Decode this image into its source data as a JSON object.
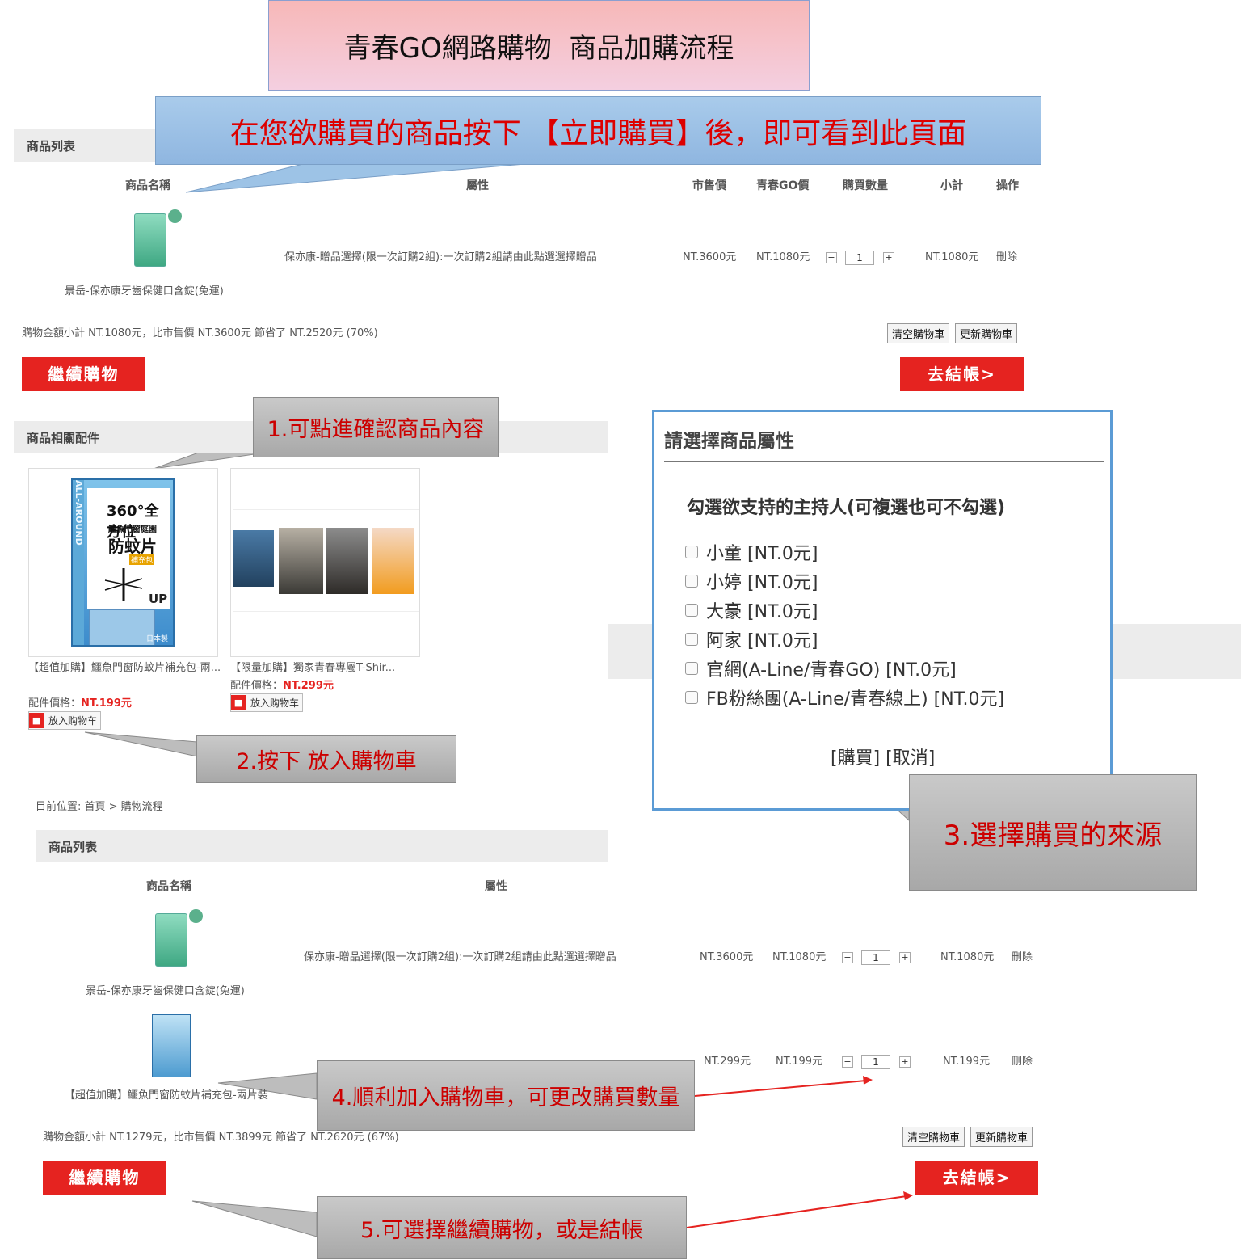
{
  "title_banner": "青春GO網路購物  商品加購流程",
  "intro_callout": "在您欲購買的商品按下 【立即購買】後，即可看到此頁面",
  "cart1": {
    "section_title": "商品列表",
    "headers": {
      "name": "商品名稱",
      "attr": "屬性",
      "market": "市售價",
      "go_price": "青春GO價",
      "qty": "購買數量",
      "subtotal": "小計",
      "action": "操作"
    },
    "item": {
      "name": "景岳-保亦康牙齒保健口含錠(兔運)",
      "attr": "保亦康-贈品選擇(限一次訂購2組):一次訂購2組請由此點選選擇贈品",
      "market": "NT.3600元",
      "go_price": "NT.1080元",
      "qty": "1",
      "subtotal": "NT.1080元",
      "action": "刪除"
    },
    "summary": "購物金額小計 NT.1080元，比市售價 NT.3600元 節省了 NT.2520元 (70%)",
    "clear_btn": "清空購物車",
    "update_btn": "更新購物車",
    "continue_btn": "繼續購物",
    "checkout_btn": "去結帳>"
  },
  "accessories": {
    "section_title": "商品相關配件",
    "items": [
      {
        "title": "【超值加購】鱷魚門窗防蚊片補充包-兩...",
        "price_label": "配件價格：",
        "price": "NT.199元",
        "add_btn": "放入购物车",
        "img_text": {
          "a": "360°全方位",
          "b": "鱷魚門窗庭園",
          "c": "防蚊片",
          "d": "補充包",
          "e": "UP",
          "f": "ALL-AROUND",
          "g": "日本製"
        }
      },
      {
        "title": "【限量加購】獨家青春專屬T-Shir...",
        "price_label": "配件價格：",
        "price": "NT.299元",
        "add_btn": "放入购物车"
      }
    ]
  },
  "step1": "1.可點進確認商品內容",
  "step2": "2.按下 放入購物車",
  "modal": {
    "title": "請選擇商品屬性",
    "question": "勾選欲支持的主持人(可複選也可不勾選)",
    "options": [
      "小童 [NT.0元]",
      "小婷 [NT.0元]",
      "大豪 [NT.0元]",
      "阿家 [NT.0元]",
      "官網(A-Line/青春GO) [NT.0元]",
      "FB粉絲團(A-Line/青春線上) [NT.0元]"
    ],
    "buy": "[購買]",
    "cancel": "[取消]"
  },
  "step3": "3.選擇購買的來源",
  "breadcrumb": "目前位置: 首頁 > 購物流程",
  "cart2": {
    "section_title": "商品列表",
    "headers": {
      "name": "商品名稱",
      "attr": "屬性"
    },
    "items": [
      {
        "name": "景岳-保亦康牙齒保健口含錠(兔運)",
        "attr": "保亦康-贈品選擇(限一次訂購2組):一次訂購2組請由此點選選擇贈品",
        "market": "NT.3600元",
        "go_price": "NT.1080元",
        "qty": "1",
        "subtotal": "NT.1080元",
        "action": "刪除"
      },
      {
        "name": "【超值加購】鱷魚門窗防蚊片補充包-兩片裝",
        "attr": "",
        "market": "NT.299元",
        "go_price": "NT.199元",
        "qty": "1",
        "subtotal": "NT.199元",
        "action": "刪除"
      }
    ],
    "summary": "購物金額小計 NT.1279元，比市售價 NT.3899元 節省了 NT.2620元 (67%)",
    "clear_btn": "清空購物車",
    "update_btn": "更新購物車",
    "continue_btn": "繼續購物",
    "checkout_btn": "去結帳>"
  },
  "step4": "4.順利加入購物車，可更改購買數量",
  "step5": "5.可選擇繼續購物，或是結帳",
  "colors": {
    "red": "#e52320",
    "blue_callout": "#9dc3e6",
    "modal_border": "#5b9bd5"
  }
}
